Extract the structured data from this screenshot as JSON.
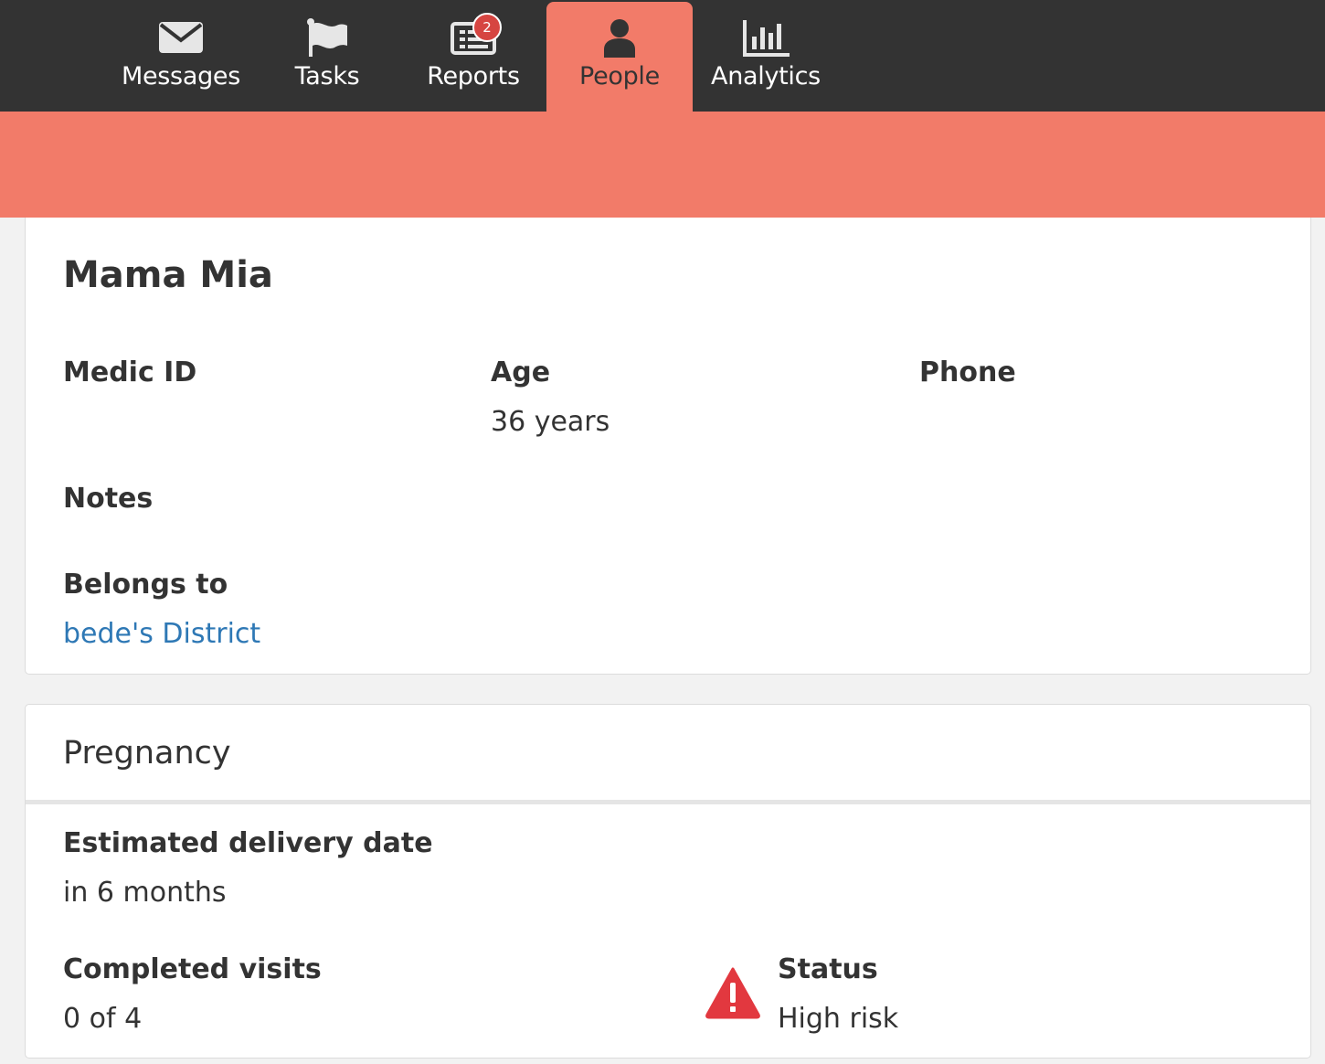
{
  "nav": {
    "tabs": [
      {
        "label": "Messages",
        "icon": "envelope-icon"
      },
      {
        "label": "Tasks",
        "icon": "flag-icon"
      },
      {
        "label": "Reports",
        "icon": "report-list-icon",
        "badge": "2"
      },
      {
        "label": "People",
        "icon": "person-icon",
        "active": true
      },
      {
        "label": "Analytics",
        "icon": "bar-chart-icon"
      }
    ]
  },
  "colors": {
    "nav_background": "#333333",
    "accent": "#f27b69",
    "link": "#2e78b5",
    "badge": "#d64541",
    "warning": "#e2383f"
  },
  "person": {
    "name": "Mama Mia",
    "fields": {
      "medic_id_label": "Medic ID",
      "medic_id_value": "",
      "age_label": "Age",
      "age_value": "36 years",
      "phone_label": "Phone",
      "phone_value": "",
      "notes_label": "Notes",
      "notes_value": "",
      "belongs_to_label": "Belongs to",
      "belongs_to_value": "bede's District"
    }
  },
  "pregnancy": {
    "title": "Pregnancy",
    "edd_label": "Estimated delivery date",
    "edd_value": "in 6 months",
    "visits_label": "Completed visits",
    "visits_value": "0 of 4",
    "status_label": "Status",
    "status_value": "High risk",
    "status_icon": "warning-triangle-icon"
  }
}
